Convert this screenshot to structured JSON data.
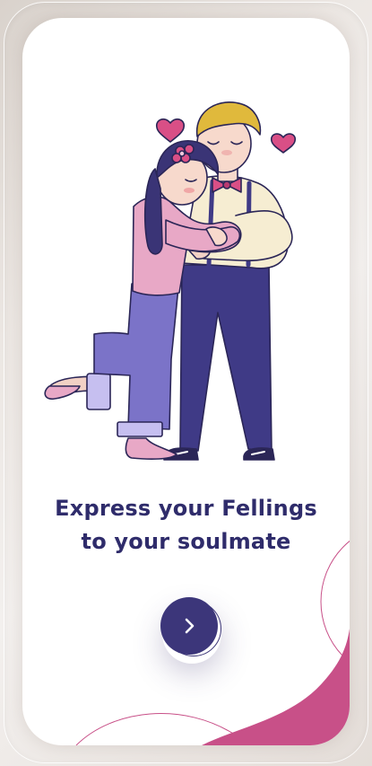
{
  "onboarding": {
    "headline_line1": "Express your Fellings",
    "headline_line2": "to your soulmate",
    "next_icon": "chevron-right-icon"
  },
  "colors": {
    "primary": "#3c367a",
    "heading": "#2f2c6b",
    "accent_pink": "#c85088",
    "heart": "#d94f86"
  }
}
